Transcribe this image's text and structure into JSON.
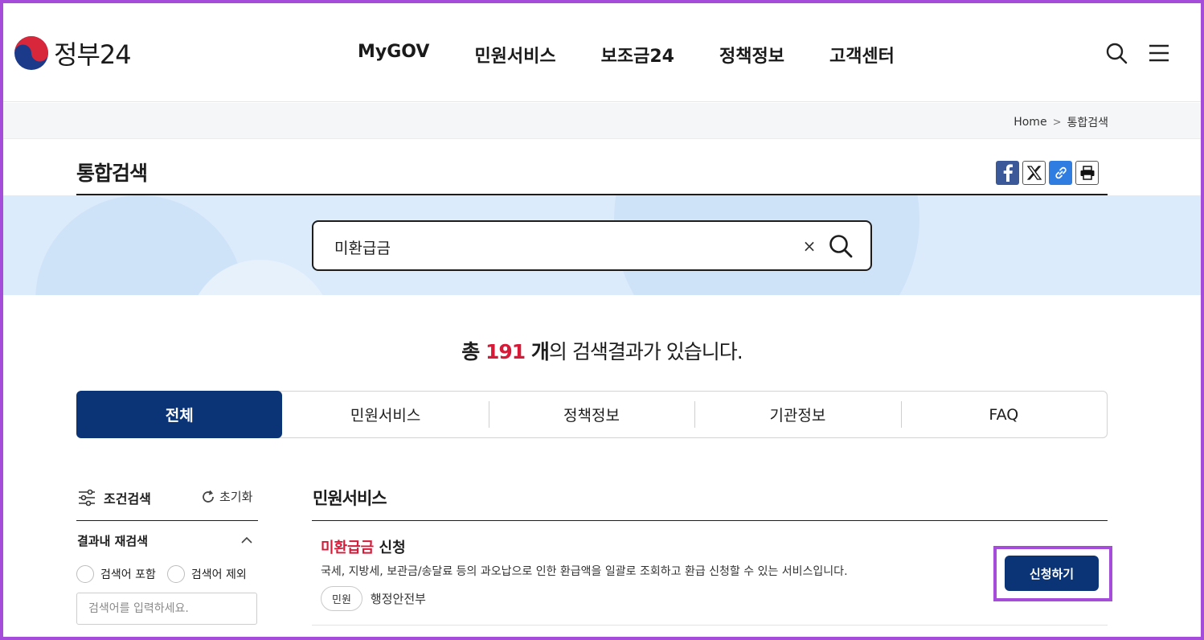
{
  "header": {
    "logo_text": "정부24",
    "nav": [
      "MyGOV",
      "민원서비스",
      "보조금24",
      "정책정보",
      "고객센터"
    ]
  },
  "breadcrumb": {
    "home": "Home",
    "current": "통합검색"
  },
  "page": {
    "title": "통합검색"
  },
  "share": {
    "icons": [
      "facebook-icon",
      "x-icon",
      "link-icon",
      "print-icon"
    ]
  },
  "search": {
    "value": "미환급금",
    "clear_label": "×"
  },
  "results": {
    "prefix": "총 ",
    "count": "191",
    "unit": " 개",
    "suffix": "의 검색결과가 있습니다."
  },
  "tabs": [
    {
      "label": "전체",
      "active": true
    },
    {
      "label": "민원서비스",
      "active": false
    },
    {
      "label": "정책정보",
      "active": false
    },
    {
      "label": "기관정보",
      "active": false
    },
    {
      "label": "FAQ",
      "active": false
    }
  ],
  "filter": {
    "title": "조건검색",
    "reset_label": "초기화",
    "refine_title": "결과내 재검색",
    "options": [
      "검색어 포함",
      "검색어 제외"
    ],
    "input_placeholder": "검색어를 입력하세요."
  },
  "section": {
    "title": "민원서비스",
    "items": [
      {
        "title_highlight": "미환급금",
        "title_rest": " 신청",
        "description": "국세, 지방세, 보관금/송달료 등의 과오납으로 인한 환급액을 일괄로 조회하고 환급 신청할 수 있는 서비스입니다.",
        "tag": "민원",
        "org": "행정안전부",
        "button_label": "신청하기"
      }
    ]
  },
  "colors": {
    "primary": "#0b3477",
    "highlight_red": "#d61a38",
    "band_blue": "#dbebfb",
    "annotation_purple": "#a64cdb"
  }
}
